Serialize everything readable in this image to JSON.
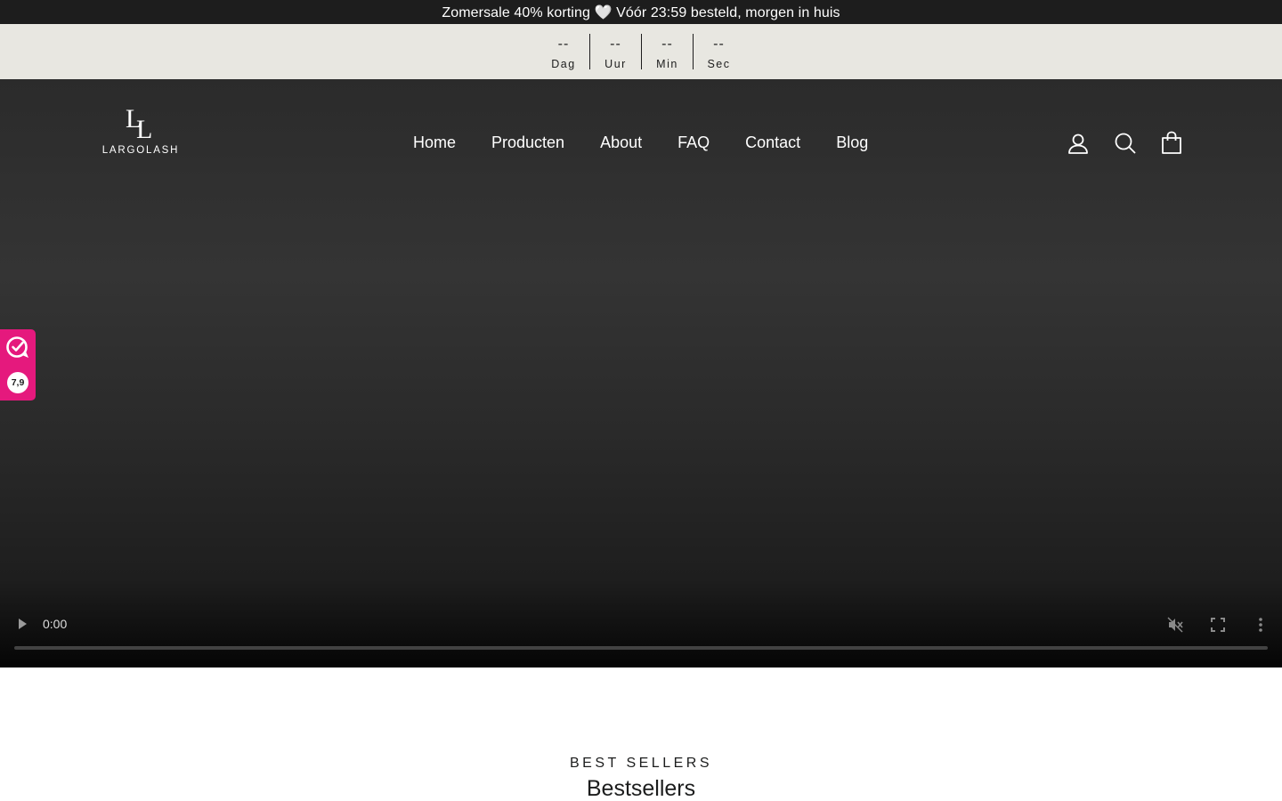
{
  "announcement": {
    "text": "Zomersale 40% korting 🤍 Vóór 23:59 besteld, morgen in huis"
  },
  "countdown": [
    {
      "value": "--",
      "label": "Dag"
    },
    {
      "value": "--",
      "label": "Uur"
    },
    {
      "value": "--",
      "label": "Min"
    },
    {
      "value": "--",
      "label": "Sec"
    }
  ],
  "header": {
    "logo_monogram": "LL",
    "logo_text": "LARGOLASH",
    "nav": [
      "Home",
      "Producten",
      "About",
      "FAQ",
      "Contact",
      "Blog"
    ],
    "icons": [
      "account-icon",
      "search-icon",
      "cart-icon"
    ]
  },
  "video": {
    "current_time": "0:00",
    "progress": 0,
    "muted": true,
    "icons": [
      "play-icon",
      "mute-icon",
      "fullscreen-icon",
      "more-options-icon"
    ]
  },
  "review_badge": {
    "score": "7,9",
    "color": "#e5197d"
  },
  "bestsellers": {
    "kicker": "BEST SELLERS",
    "title": "Bestsellers"
  },
  "colors": {
    "announcement_bg": "#1d1d1d",
    "countdown_bg": "#e8e7e1",
    "hero_bg": "#2f2f2f"
  }
}
